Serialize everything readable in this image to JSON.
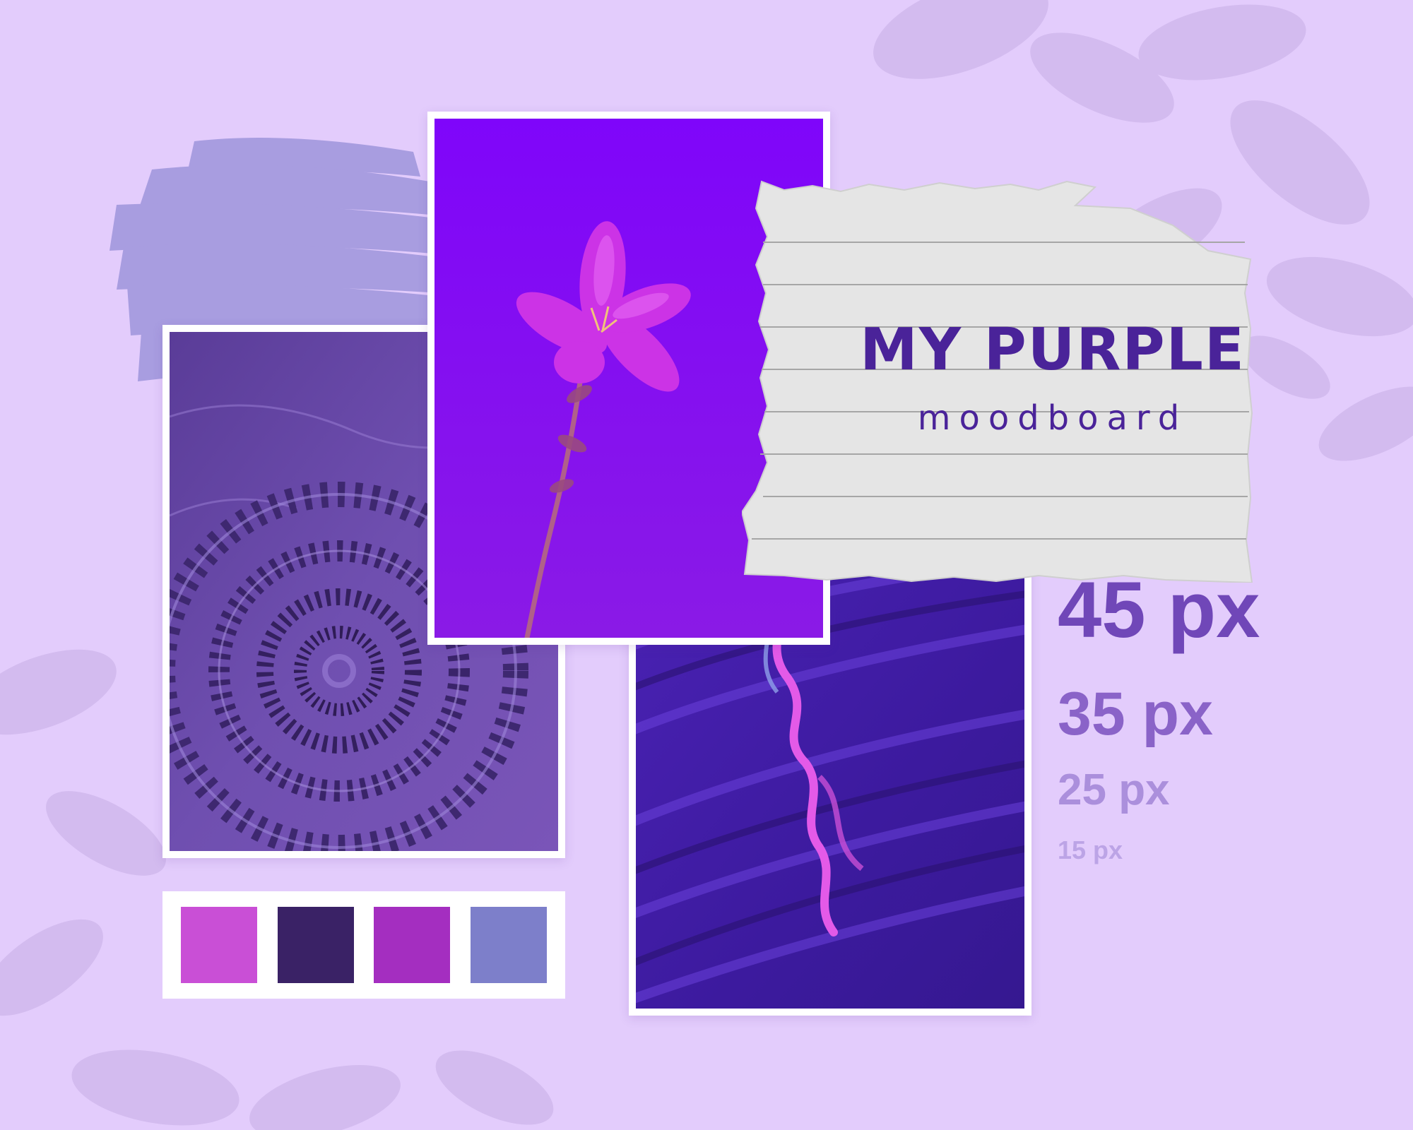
{
  "title": {
    "line1": "MY PURPLE",
    "line2": "moodboard"
  },
  "type_sizes": [
    "45 px",
    "35 px",
    "25 px",
    "15 px"
  ],
  "palette": [
    "#c94fd6",
    "#3a2266",
    "#a42ec0",
    "#7d7fca"
  ],
  "colors": {
    "background": "#e3ccfc",
    "brush_stroke": "#a89de0",
    "title_text": "#4a2399",
    "paper": "#e5e5e5"
  },
  "images": {
    "fossil": "ammonite-fossil-photo",
    "flower": "pink-flower-photo",
    "paint": "purple-paint-texture-photo"
  }
}
